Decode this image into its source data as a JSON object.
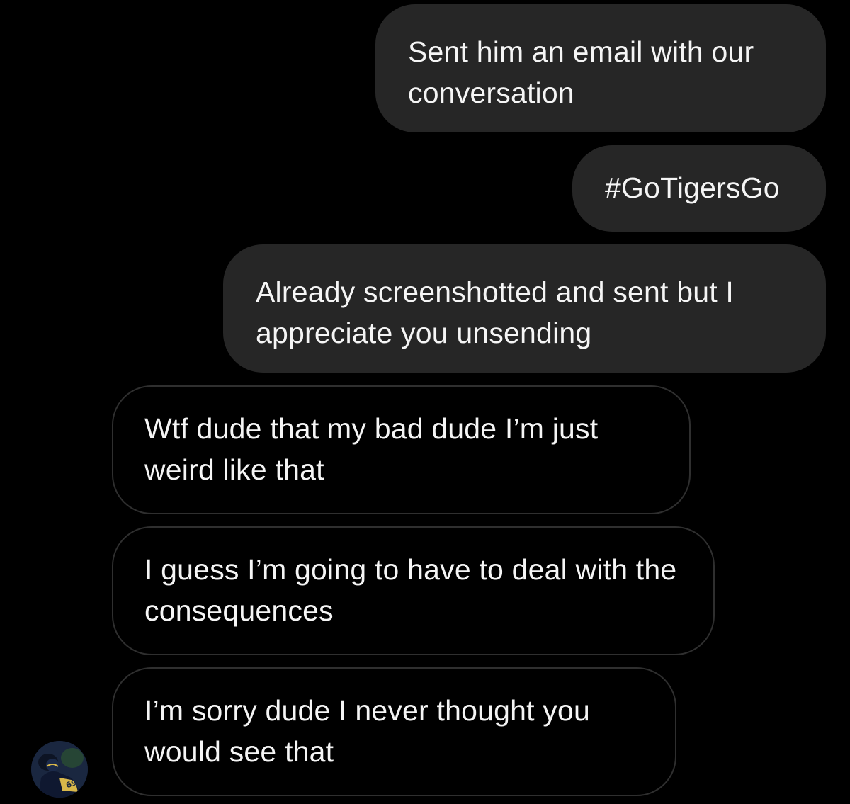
{
  "conversation": {
    "messages": [
      {
        "sender": "me",
        "text": "Sent him an email with our conversation"
      },
      {
        "sender": "me",
        "text": "#GoTigersGo"
      },
      {
        "sender": "me",
        "text": "Already screenshotted and sent but I appreciate you unsending"
      },
      {
        "sender": "them",
        "text": "Wtf dude that my bad dude I’m just weird like that"
      },
      {
        "sender": "them",
        "text": "I guess I’m going to have to deal with the consequences"
      },
      {
        "sender": "them",
        "text": "I’m sorry dude I never thought you would see that"
      }
    ],
    "contact": {
      "avatar_icon": "profile-photo-football-player"
    }
  },
  "colors": {
    "background": "#000000",
    "sent_bubble": "#262626",
    "received_bubble_border": "#2f2f2f",
    "text": "#f5f5f5"
  }
}
